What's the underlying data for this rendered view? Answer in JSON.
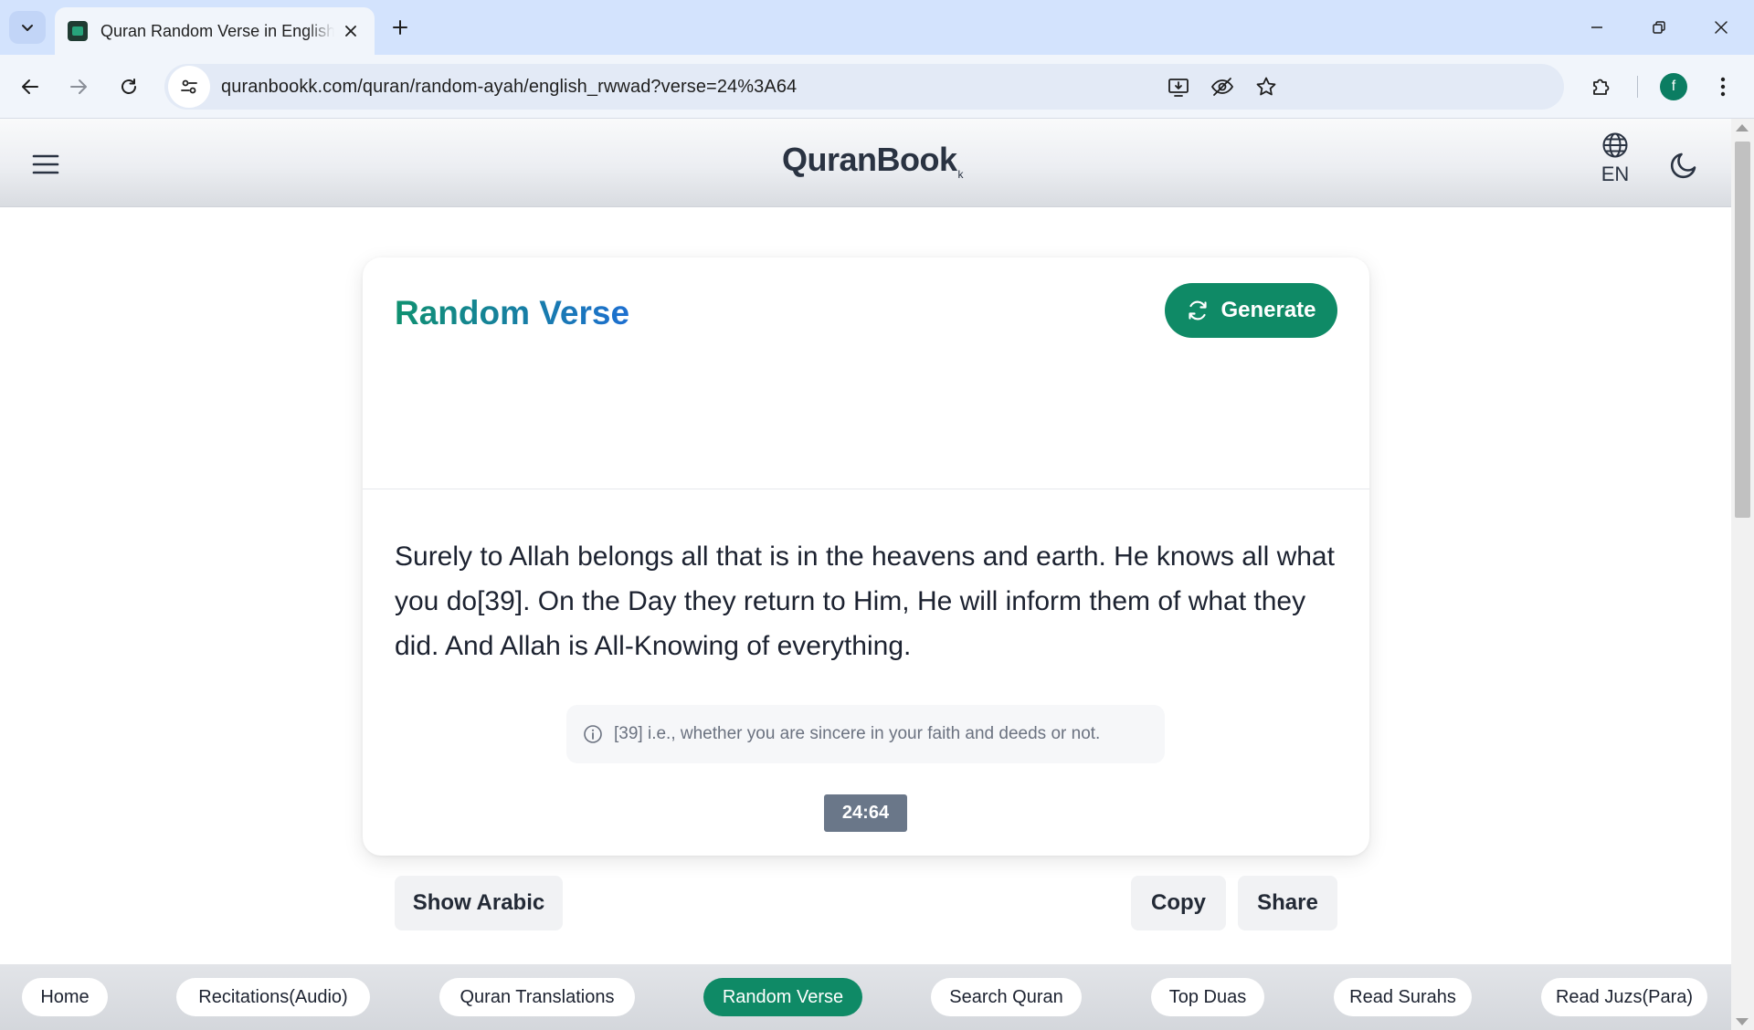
{
  "browser": {
    "tab_title": "Quran Random Verse in English",
    "url": "quranbookk.com/quran/random-ayah/english_rwwad?verse=24%3A64",
    "profile_initial": "f"
  },
  "header": {
    "logo": "QuranBook",
    "logo_suffix": "k",
    "language": "EN"
  },
  "card": {
    "title": "Random Verse",
    "generate_label": "Generate",
    "verse_text": "Surely to Allah belongs all that is in the heavens and earth. He knows all what you do[39]. On the Day they return to Him, He will inform them of what they did. And Allah is All-Knowing of everything.",
    "footnote": "[39] i.e., whether you are sincere in your faith and deeds or not.",
    "reference": "24:64",
    "show_arabic_label": "Show Arabic",
    "copy_label": "Copy",
    "share_label": "Share"
  },
  "bottom_nav": {
    "items": [
      "Home",
      "Recitations(Audio)",
      "Quran Translations",
      "Random Verse",
      "Search Quran",
      "Top Duas",
      "Read Surahs",
      "Read Juzs(Para)"
    ],
    "active": "Random Verse"
  },
  "colors": {
    "accent": "#0f8a66",
    "title_gradient_start": "#109170",
    "title_gradient_end": "#1d6fd1",
    "badge": "#6a7789"
  }
}
